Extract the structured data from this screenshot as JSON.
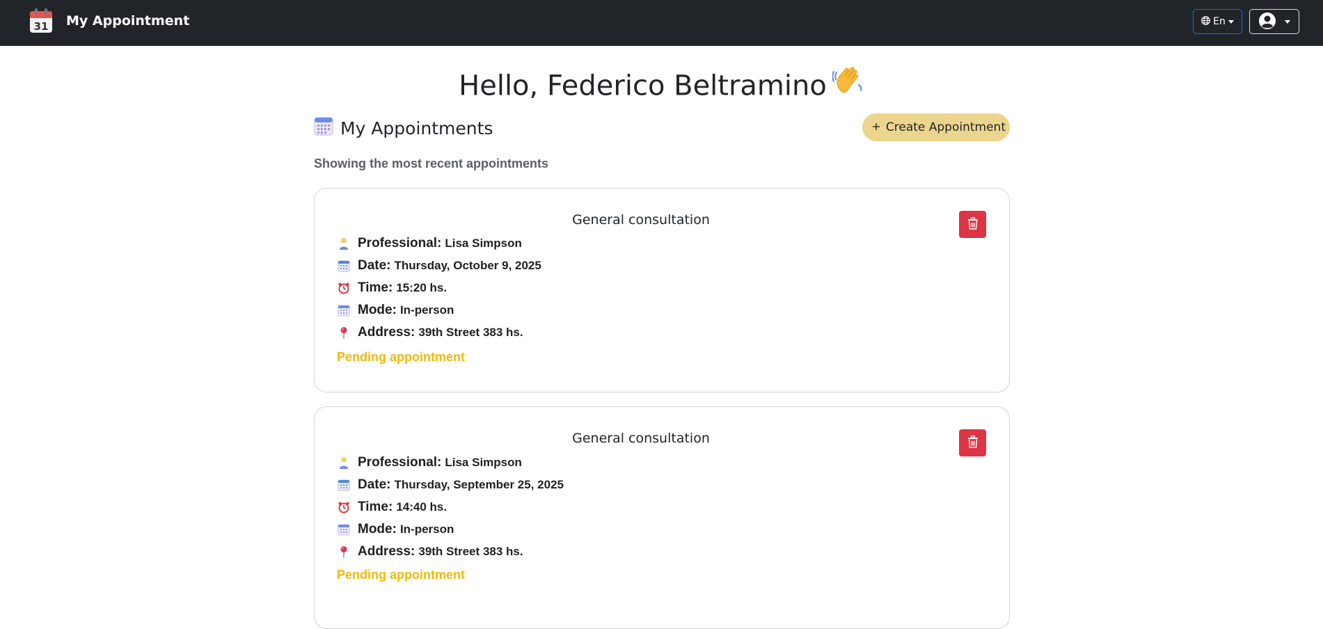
{
  "app": {
    "title": "My Appointment",
    "language_label": "En"
  },
  "greeting": {
    "text": "Hello, Federico Beltramino"
  },
  "section": {
    "title": "My Appointments",
    "create_label": "Create Appointment",
    "subtitle": "Showing the most recent appointments"
  },
  "labels": {
    "professional": "Professional:",
    "date": "Date:",
    "time": "Time:",
    "mode": "Mode:",
    "address": "Address:"
  },
  "appointments": [
    {
      "title": "General consultation",
      "professional": "Lisa Simpson",
      "date": "Thursday, October 9, 2025",
      "time": "15:20 hs.",
      "mode": "In-person",
      "address": "39th Street 383 hs.",
      "status": "Pending appointment"
    },
    {
      "title": "General consultation",
      "professional": "Lisa Simpson",
      "date": "Thursday, September 25, 2025",
      "time": "14:40 hs.",
      "mode": "In-person",
      "address": "39th Street 383 hs.",
      "status": "Pending appointment"
    }
  ],
  "colors": {
    "navbar": "#212529",
    "create_button": "#ecd58c",
    "delete_button": "#dc3545",
    "status_pending": "#f0b90b",
    "language_border": "#0d6efd"
  },
  "icons": {
    "brand": "calendar-31-icon",
    "language": "globe-icon",
    "user": "user-circle-icon",
    "wave": "waving-hand-icon",
    "section": "calendar-icon",
    "create": "plus-icon",
    "delete": "trash-icon",
    "professional": "person-icon",
    "date": "calendar-icon",
    "time": "alarm-clock-icon",
    "mode": "calendar-icon",
    "address": "pin-icon"
  }
}
